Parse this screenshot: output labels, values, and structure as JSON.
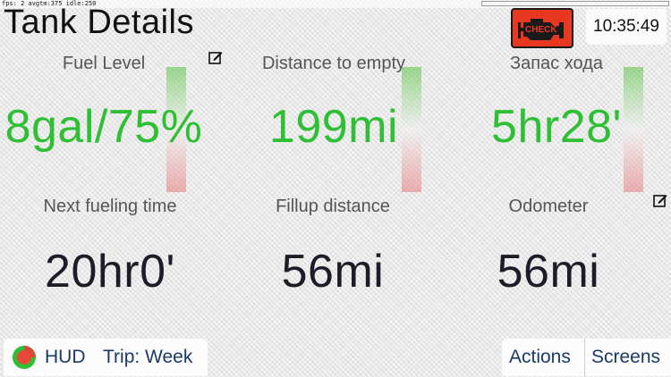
{
  "debug": {
    "stats": "fps: 2 avgtm:375 idle:250"
  },
  "header": {
    "title": "Tank Details",
    "check_engine_label": "CHECK",
    "clock": "10:35:49"
  },
  "tiles": [
    {
      "label": "Fuel Level",
      "value": "8gal/75%"
    },
    {
      "label": "Distance to empty",
      "value": "199mi"
    },
    {
      "label": "Запас хода",
      "value": "5hr28'"
    },
    {
      "label": "Next fueling time",
      "value": "20hr0'"
    },
    {
      "label": "Fillup distance",
      "value": "56mi"
    },
    {
      "label": "Odometer",
      "value": "56mi"
    }
  ],
  "toolbar": {
    "hud_label": "HUD",
    "trip_label": "Trip: Week",
    "actions_label": "Actions",
    "screens_label": "Screens"
  },
  "icons": {
    "check_engine": "engine-icon",
    "edit": "pencil-square-icon",
    "hud": "circle-gauge-icon"
  },
  "colors": {
    "value_green": "#2fbf35",
    "value_dark": "#1d1d2a",
    "check_engine_bg": "#e8381f",
    "button_text": "#1a3a66"
  }
}
